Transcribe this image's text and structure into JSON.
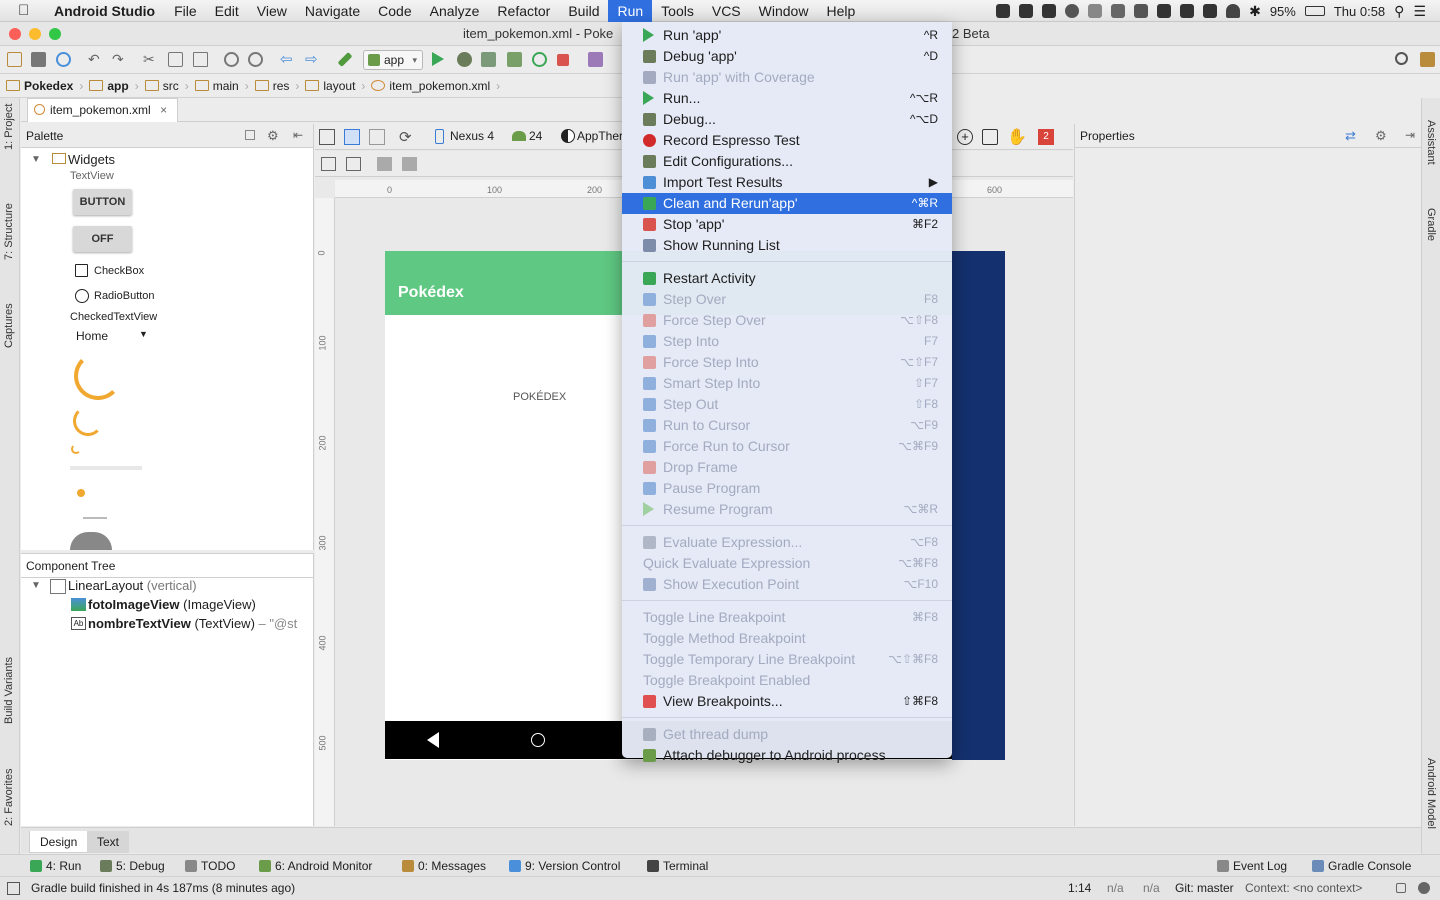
{
  "menubar": {
    "app_name": "Android Studio",
    "items": [
      "File",
      "Edit",
      "View",
      "Navigate",
      "Code",
      "Analyze",
      "Refactor",
      "Build",
      "Run",
      "Tools",
      "VCS",
      "Window",
      "Help"
    ],
    "active_item": "Run",
    "battery": "95%",
    "clock": "Thu 0:58"
  },
  "window": {
    "title": "item_pokemon.xml - Poke",
    "title_suffix": "2 Beta"
  },
  "toolbar": {
    "run_config": "app"
  },
  "breadcrumb": [
    "Pokedex",
    "app",
    "src",
    "main",
    "res",
    "layout",
    "item_pokemon.xml"
  ],
  "editor": {
    "file_tab": "item_pokemon.xml"
  },
  "palette": {
    "title": "Palette",
    "group": "Widgets",
    "items": {
      "textview": "TextView",
      "button": "BUTTON",
      "toggle": "OFF",
      "checkbox": "CheckBox",
      "radio": "RadioButton",
      "checked_textview": "CheckedTextView",
      "spinner": "Home"
    }
  },
  "component_tree": {
    "title": "Component Tree",
    "root": "LinearLayout",
    "root_type": "(vertical)",
    "children": [
      {
        "name": "fotoImageView",
        "type": "(ImageView)"
      },
      {
        "name": "nombreTextView",
        "type": "(TextView)",
        "extra": "– \"@st"
      }
    ]
  },
  "design_toolbar": {
    "device": "Nexus 4",
    "api": "24",
    "theme": "AppTher",
    "badge": "2"
  },
  "rulers": {
    "top": [
      "0",
      "100",
      "200",
      "600"
    ],
    "left": [
      "0",
      "100",
      "200",
      "300",
      "400",
      "500"
    ]
  },
  "phone": {
    "app_bar_title": "Pokédex",
    "item_label": "POKÉDEX"
  },
  "properties": {
    "title": "Properties"
  },
  "bottom_tabs": {
    "design": "Design",
    "text": "Text"
  },
  "side_tabs": {
    "left": [
      "1: Project",
      "7: Structure",
      "Captures",
      "Build Variants",
      "2: Favorites"
    ],
    "right": [
      "Assistant",
      "Gradle",
      "Android Model"
    ]
  },
  "tool_windows": {
    "run": "4: Run",
    "debug": "5: Debug",
    "todo": "TODO",
    "monitor": "6: Android Monitor",
    "messages": "0: Messages",
    "vcs": "9: Version Control",
    "terminal": "Terminal",
    "event_log": "Event Log",
    "gradle_console": "Gradle Console"
  },
  "statusbar": {
    "message": "Gradle build finished in 4s 187ms (8 minutes ago)",
    "position": "1:14",
    "na1": "n/a",
    "na2": "n/a",
    "git": "Git: master",
    "context": "Context: <no context>"
  },
  "run_menu": {
    "items": [
      {
        "label": "Run 'app'",
        "shortcut": "^R",
        "enabled": true,
        "icon": "run-icon",
        "color": "#3aa757"
      },
      {
        "label": "Debug 'app'",
        "shortcut": "^D",
        "enabled": true,
        "icon": "bug-icon",
        "color": "#6b7c5a"
      },
      {
        "label": "Run 'app' with Coverage",
        "shortcut": "",
        "enabled": false,
        "icon": "coverage-icon",
        "color": "#a4aac0"
      },
      {
        "label": "Run...",
        "shortcut": "^⌥R",
        "enabled": true,
        "icon": "run-icon",
        "color": "#3aa757"
      },
      {
        "label": "Debug...",
        "shortcut": "^⌥D",
        "enabled": true,
        "icon": "bug-icon",
        "color": "#6b7c5a"
      },
      {
        "label": "Record Espresso Test",
        "shortcut": "",
        "enabled": true,
        "icon": "record-icon",
        "color": "#d12a2a"
      },
      {
        "label": "Edit Configurations...",
        "shortcut": "",
        "enabled": true,
        "icon": "edit-config-icon",
        "color": "#6b7c5a"
      },
      {
        "label": "Import Test Results",
        "shortcut": "▶",
        "enabled": true,
        "icon": "import-icon",
        "color": "#4d8fd6"
      },
      {
        "label": "Clean and Rerun'app'",
        "shortcut": "^⌘R",
        "enabled": true,
        "icon": "rerun-icon",
        "color": "#3aa757"
      },
      {
        "label": "Stop 'app'",
        "shortcut": "⌘F2",
        "enabled": true,
        "icon": "stop-icon",
        "color": "#d9534f"
      },
      {
        "label": "Show Running List",
        "shortcut": "",
        "enabled": true,
        "icon": "list-icon",
        "color": "#7d8ca8"
      },
      {
        "label": "Restart Activity",
        "shortcut": "",
        "enabled": true,
        "icon": "restart-icon",
        "color": "#3aa757"
      },
      {
        "label": "Step Over",
        "shortcut": "F8",
        "enabled": false,
        "icon": "step-over-icon",
        "color": "#8fb0dc"
      },
      {
        "label": "Force Step Over",
        "shortcut": "⌥⇧F8",
        "enabled": false,
        "icon": "force-step-over-icon",
        "color": "#e0a0a0"
      },
      {
        "label": "Step Into",
        "shortcut": "F7",
        "enabled": false,
        "icon": "step-into-icon",
        "color": "#8fb0dc"
      },
      {
        "label": "Force Step Into",
        "shortcut": "⌥⇧F7",
        "enabled": false,
        "icon": "force-step-into-icon",
        "color": "#e0a0a0"
      },
      {
        "label": "Smart Step Into",
        "shortcut": "⇧F7",
        "enabled": false,
        "icon": "smart-step-icon",
        "color": "#8fb0dc"
      },
      {
        "label": "Step Out",
        "shortcut": "⇧F8",
        "enabled": false,
        "icon": "step-out-icon",
        "color": "#8fb0dc"
      },
      {
        "label": "Run to Cursor",
        "shortcut": "⌥F9",
        "enabled": false,
        "icon": "run-cursor-icon",
        "color": "#8fb0dc"
      },
      {
        "label": "Force Run to Cursor",
        "shortcut": "⌥⌘F9",
        "enabled": false,
        "icon": "force-run-cursor-icon",
        "color": "#8fb0dc"
      },
      {
        "label": "Drop Frame",
        "shortcut": "",
        "enabled": false,
        "icon": "drop-frame-icon",
        "color": "#e0a0a0"
      },
      {
        "label": "Pause Program",
        "shortcut": "",
        "enabled": false,
        "icon": "pause-icon",
        "color": "#8fb0dc"
      },
      {
        "label": "Resume Program",
        "shortcut": "⌥⌘R",
        "enabled": false,
        "icon": "resume-icon",
        "color": "#a0d0a0"
      },
      {
        "label": "Evaluate Expression...",
        "shortcut": "⌥F8",
        "enabled": false,
        "icon": "evaluate-icon",
        "color": "#b0b8c8"
      },
      {
        "label": "Quick Evaluate Expression",
        "shortcut": "⌥⌘F8",
        "enabled": false,
        "icon": "",
        "color": ""
      },
      {
        "label": "Show Execution Point",
        "shortcut": "⌥F10",
        "enabled": false,
        "icon": "execution-point-icon",
        "color": "#a0b0d0"
      },
      {
        "label": "Toggle Line Breakpoint",
        "shortcut": "⌘F8",
        "enabled": false,
        "icon": "",
        "color": ""
      },
      {
        "label": "Toggle Method Breakpoint",
        "shortcut": "",
        "enabled": false,
        "icon": "",
        "color": ""
      },
      {
        "label": "Toggle Temporary Line Breakpoint",
        "shortcut": "⌥⇧⌘F8",
        "enabled": false,
        "icon": "",
        "color": ""
      },
      {
        "label": "Toggle Breakpoint Enabled",
        "shortcut": "",
        "enabled": false,
        "icon": "",
        "color": ""
      },
      {
        "label": "View Breakpoints...",
        "shortcut": "⇧⌘F8",
        "enabled": true,
        "icon": "breakpoints-icon",
        "color": "#e05050"
      },
      {
        "label": "Get thread dump",
        "shortcut": "",
        "enabled": false,
        "icon": "thread-dump-icon",
        "color": "#a8b0c0"
      },
      {
        "label": "Attach debugger to Android process",
        "shortcut": "",
        "enabled": true,
        "icon": "attach-debugger-icon",
        "color": "#6b9c4a"
      }
    ],
    "selected_index": 8
  }
}
